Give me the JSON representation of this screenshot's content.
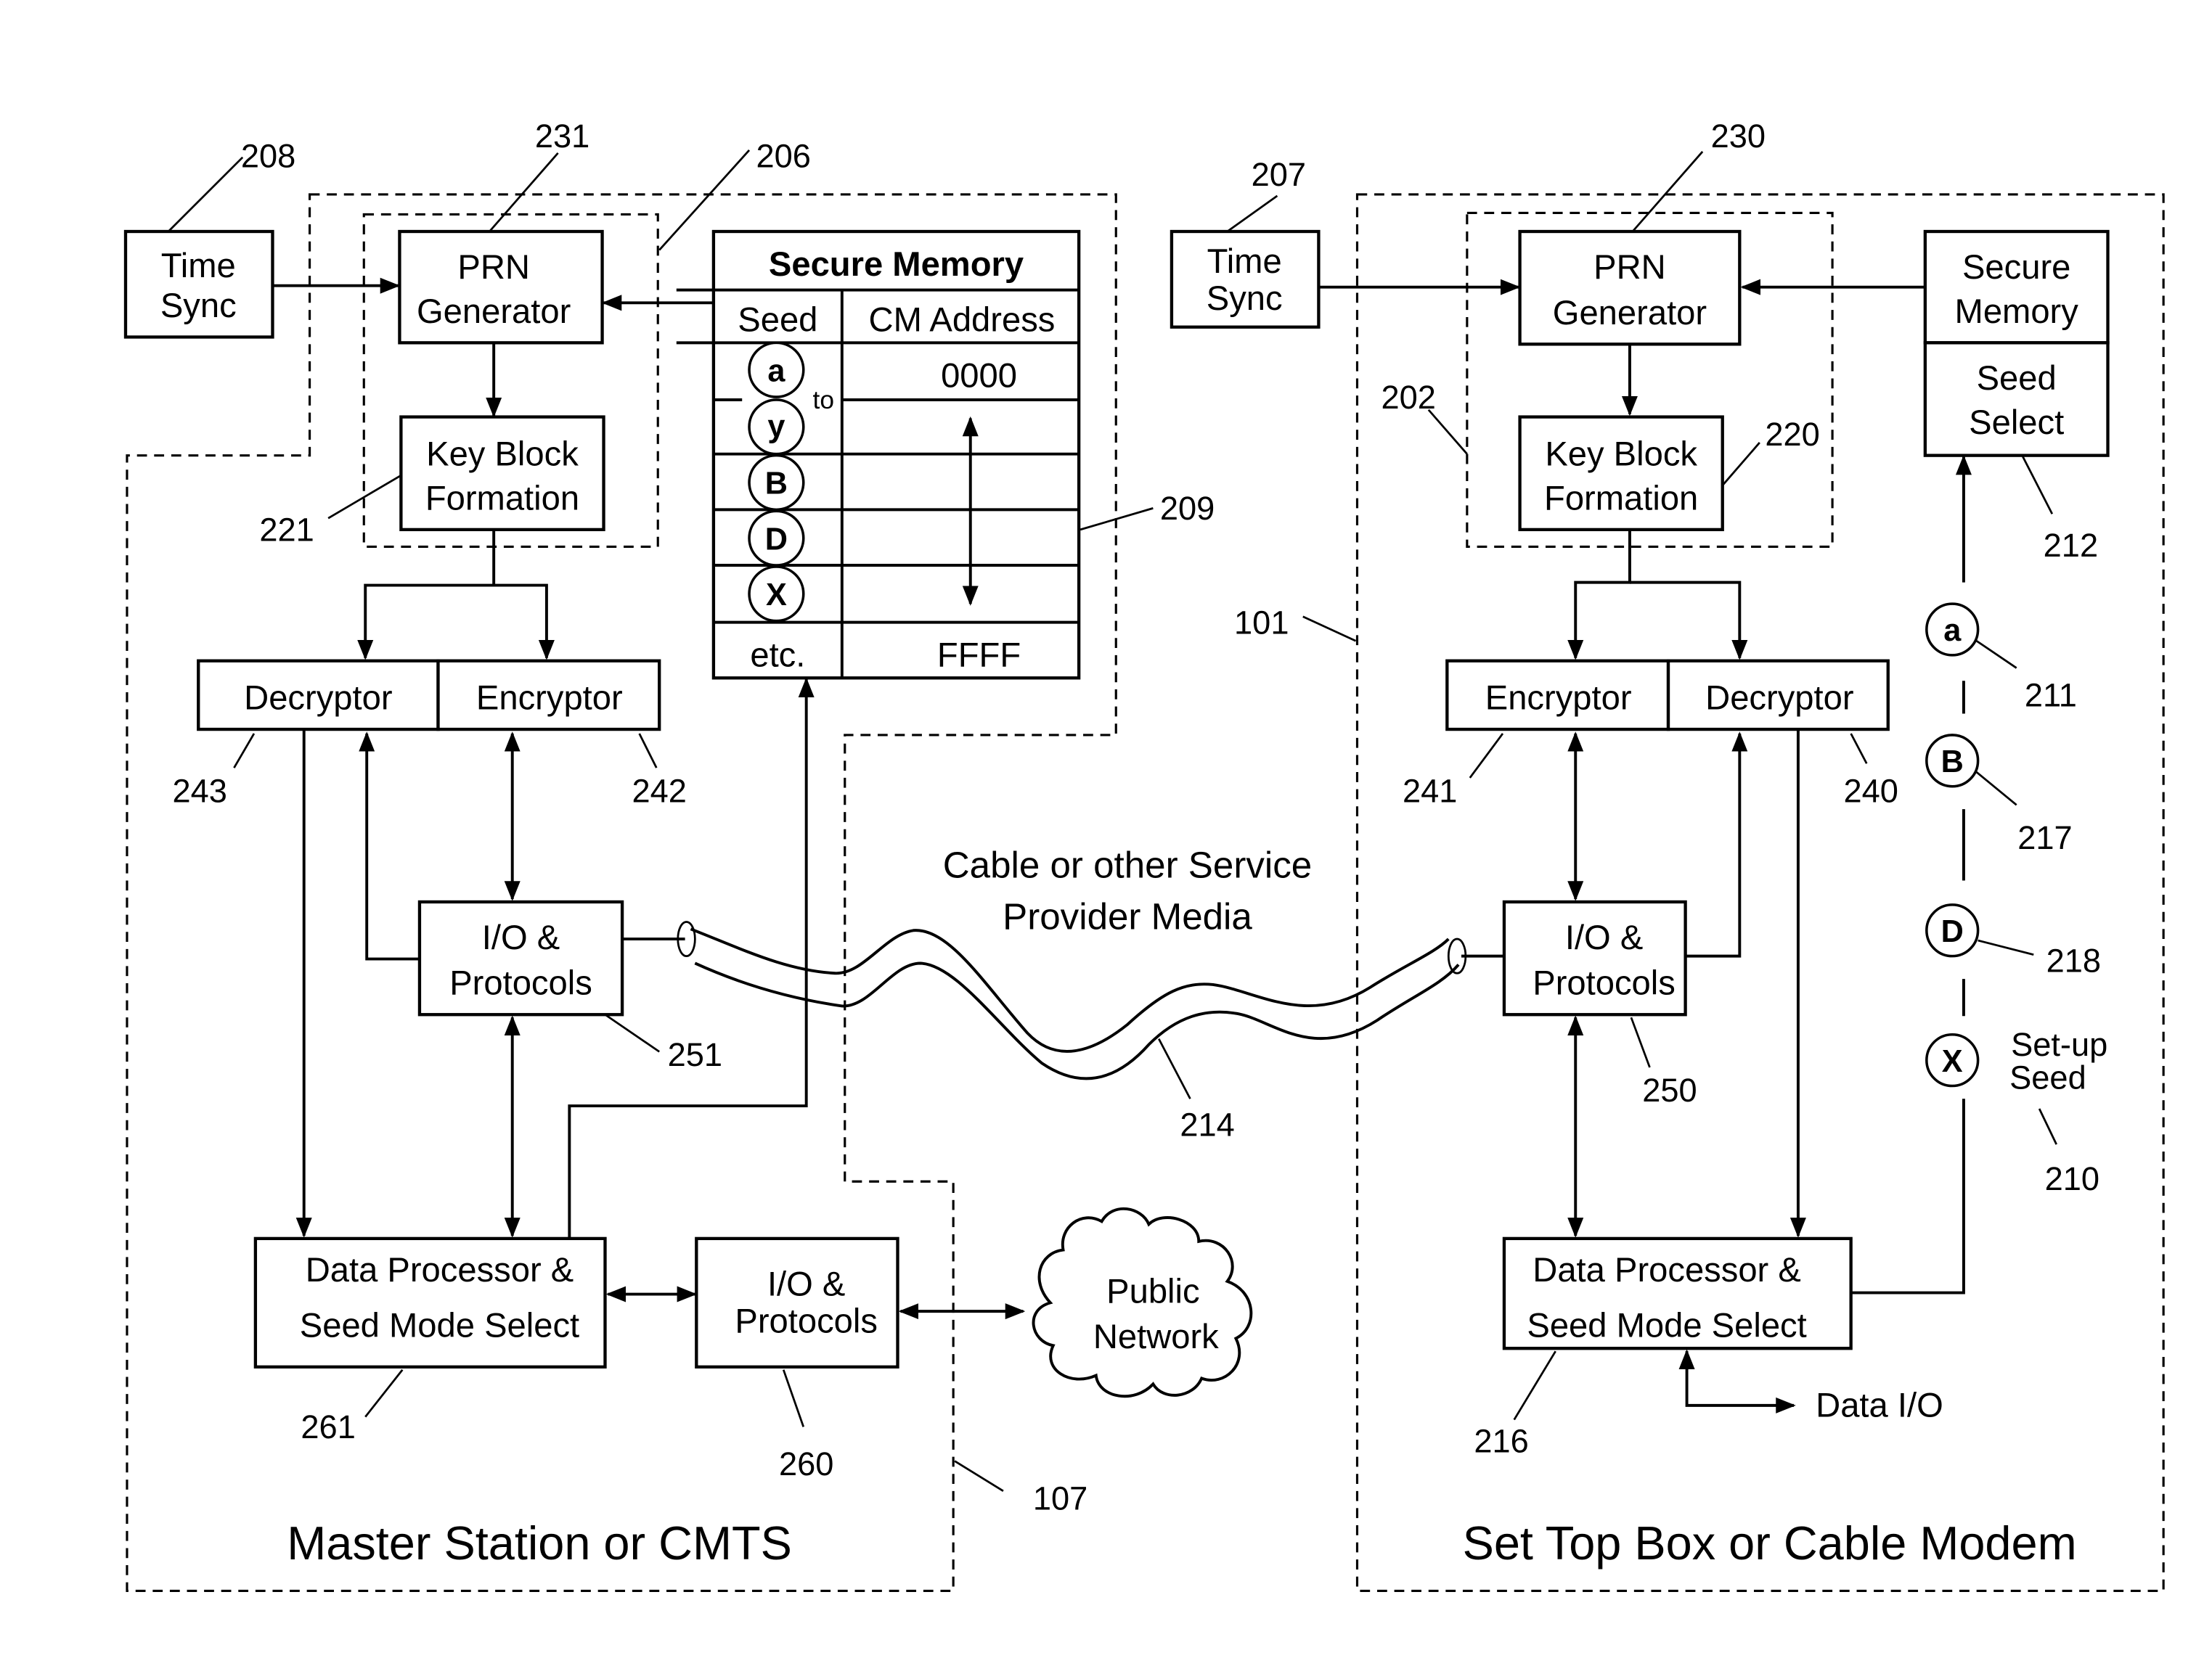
{
  "figure": {
    "left_station": {
      "title": "Master Station or CMTS",
      "ref": "107",
      "time_sync": {
        "line1": "Time",
        "line2": "Sync",
        "ref": "208"
      },
      "prn_generator": {
        "line1": "PRN",
        "line2": "Generator",
        "ref": "231"
      },
      "key_block": {
        "line1": "Key Block",
        "line2": "Formation",
        "ref": "221"
      },
      "group_ref": "206",
      "decryptor": {
        "label": "Decryptor",
        "ref": "243"
      },
      "encryptor": {
        "label": "Encryptor",
        "ref": "242"
      },
      "io": {
        "line1": "I/O &",
        "line2": "Protocols",
        "ref": "251"
      },
      "data_processor": {
        "line1": "Data Processor &",
        "line2": "Seed Mode Select",
        "ref": "261"
      },
      "io_public": {
        "line1": "I/O &",
        "line2": "Protocols",
        "ref": "260"
      },
      "secure_memory": {
        "title": "Secure Memory",
        "ref": "209",
        "col_seed": "Seed",
        "col_address": "CM Address",
        "seeds": [
          "a",
          "y",
          "B",
          "D",
          "X"
        ],
        "to_label": "to",
        "first_address": "0000",
        "last_seed": "etc.",
        "last_address": "FFFF"
      }
    },
    "public_network": {
      "line1": "Public",
      "line2": "Network"
    },
    "media": {
      "line1": "Cable or other Service",
      "line2": "Provider Media",
      "ref": "214"
    },
    "right_station": {
      "title": "Set Top Box or Cable Modem",
      "ref": "101",
      "time_sync": {
        "line1": "Time",
        "line2": "Sync",
        "ref": "207"
      },
      "prn_generator": {
        "line1": "PRN",
        "line2": "Generator",
        "ref": "230"
      },
      "key_block": {
        "line1": "Key Block",
        "line2": "Formation",
        "ref": "220"
      },
      "group_ref": "202",
      "secure_memory": {
        "line1": "Secure",
        "line2": "Memory"
      },
      "seed_select": {
        "line1": "Seed",
        "line2": "Select",
        "ref": "212"
      },
      "encryptor": {
        "label": "Encryptor",
        "ref": "241"
      },
      "decryptor": {
        "label": "Decryptor",
        "ref": "240"
      },
      "io": {
        "line1": "I/O &",
        "line2": "Protocols",
        "ref": "250"
      },
      "data_processor": {
        "line1": "Data Processor &",
        "line2": "Seed Mode Select",
        "ref": "216"
      },
      "data_io": "Data I/O",
      "seed_chain": [
        {
          "seed": "a",
          "ref": "211"
        },
        {
          "seed": "B",
          "ref": "217"
        },
        {
          "seed": "D",
          "ref": "218"
        },
        {
          "seed": "X",
          "ref": "210",
          "note_line1": "Set-up",
          "note_line2": "Seed"
        }
      ]
    }
  }
}
